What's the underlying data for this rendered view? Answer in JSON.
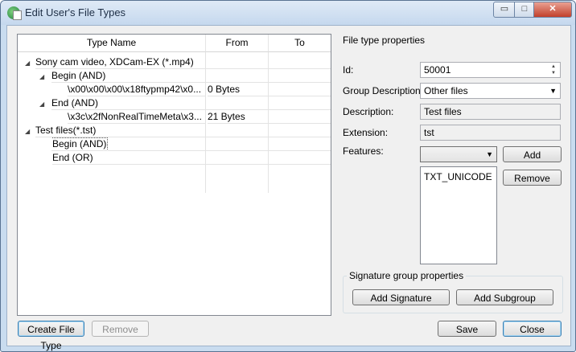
{
  "window": {
    "title": "Edit User's File Types"
  },
  "title_buttons": {
    "minimize": "▭",
    "maximize": "□",
    "close": "✕"
  },
  "tree": {
    "columns": [
      "Type Name",
      "From",
      "To"
    ],
    "rows": [
      {
        "name": "Sony cam video, XDCam-EX (*.mp4)",
        "from": "",
        "to": ""
      },
      {
        "name": "Begin (AND)",
        "from": "",
        "to": ""
      },
      {
        "name": "\\x00\\x00\\x00\\x18ftypmp42\\x0...",
        "from": "0 Bytes",
        "to": ""
      },
      {
        "name": "End (AND)",
        "from": "",
        "to": ""
      },
      {
        "name": "\\x3c\\x2fNonRealTimeMeta\\x3...",
        "from": "21 Bytes",
        "to": ""
      },
      {
        "name": "Test files(*.tst)",
        "from": "",
        "to": ""
      },
      {
        "name": "Begin (AND)",
        "from": "",
        "to": ""
      },
      {
        "name": "End (OR)",
        "from": "",
        "to": ""
      }
    ]
  },
  "props": {
    "section_title": "File type properties",
    "id_label": "Id:",
    "id_value": "50001",
    "group_label": "Group Description:",
    "group_value": "Other files",
    "desc_label": "Description:",
    "desc_value": "Test files",
    "ext_label": "Extension:",
    "ext_value": "tst",
    "features_label": "Features:",
    "features_value": "",
    "features_list": [
      "TXT_UNICODE"
    ],
    "add_label": "Add",
    "remove_label": "Remove"
  },
  "signature": {
    "group_title": "Signature group properties",
    "add_signature": "Add Signature",
    "add_subgroup": "Add Subgroup"
  },
  "footer": {
    "create": "Create File Type",
    "remove": "Remove",
    "save": "Save",
    "close": "Close"
  }
}
